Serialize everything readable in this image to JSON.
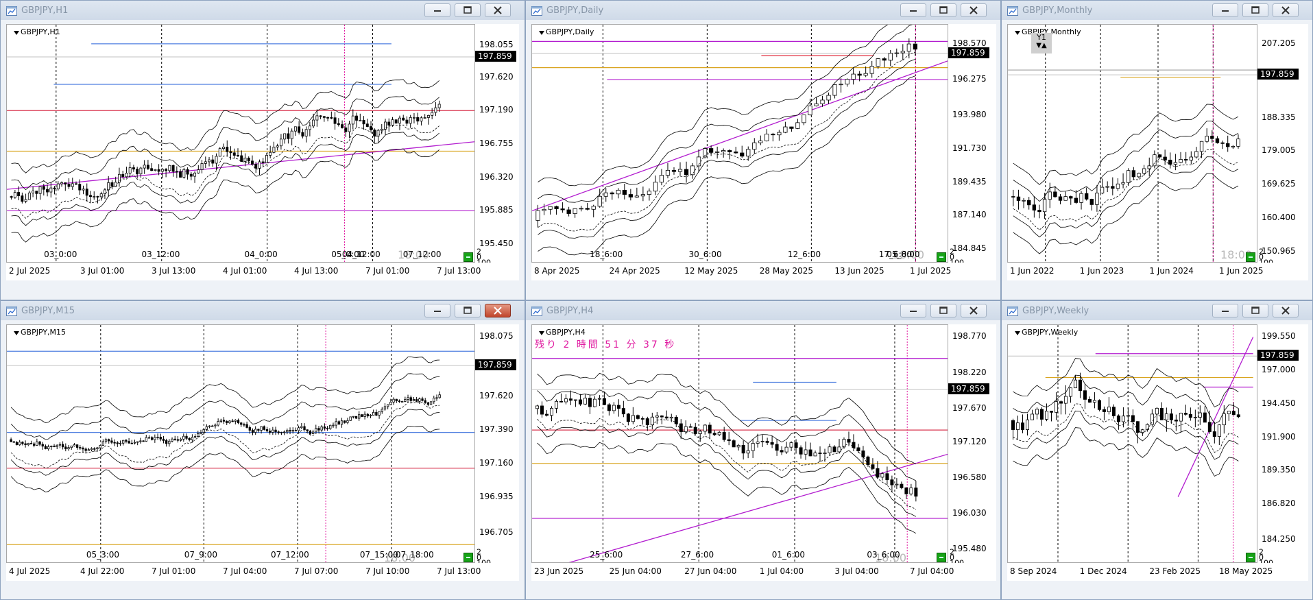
{
  "windows": [
    {
      "id": "h1",
      "title": "GBPJPY,H1",
      "symbol_label": "GBPJPY,H1",
      "time_stamp": "18:00",
      "current_price": "197.859",
      "price_labels": [
        "198.055",
        "197.620",
        "197.190",
        "196.755",
        "196.320",
        "195.885",
        "195.450"
      ],
      "intraday_labels": [
        "03_0:00",
        "03_12:00",
        "04_0:00",
        "04_12:00",
        "05_0:00",
        "07_12:00"
      ],
      "date_labels": [
        "2 Jul 2025",
        "3 Jul 01:00",
        "3 Jul 13:00",
        "4 Jul 01:00",
        "4 Jul 13:00",
        "7 Jul 01:00",
        "7 Jul 13:00"
      ],
      "scale_markers": [
        "2",
        "0",
        "100"
      ],
      "close_active": false
    },
    {
      "id": "daily",
      "title": "GBPJPY,Daily",
      "symbol_label": "GBPJPY,Daily",
      "time_stamp": "18:00",
      "current_price": "197.859",
      "price_labels": [
        "198.570",
        "196.275",
        "193.980",
        "191.730",
        "189.435",
        "187.140",
        "184.845"
      ],
      "intraday_labels": [
        "18_6:00",
        "30_6:00",
        "12_6:00",
        "05_6:00",
        "17_6:00"
      ],
      "date_labels": [
        "8 Apr 2025",
        "24 Apr 2025",
        "12 May 2025",
        "28 May 2025",
        "13 Jun 2025",
        "1 Jul 2025"
      ],
      "scale_markers": [
        "2",
        "0",
        "100"
      ],
      "close_active": false
    },
    {
      "id": "monthly",
      "title": "GBPJPY,Monthly",
      "symbol_label": "GBPJPY,Monthly",
      "time_stamp": "18:00",
      "current_price": "197.859",
      "price_labels": [
        "207.205",
        "197.859",
        "188.335",
        "179.005",
        "169.625",
        "160.400",
        "150.965"
      ],
      "date_labels": [
        "1 Jun 2022",
        "1 Jun 2023",
        "1 Jun 2024",
        "1 Jun 2025"
      ],
      "badge": "Y1",
      "scale_markers": [
        "2",
        "0",
        "100"
      ],
      "close_active": false
    },
    {
      "id": "m15",
      "title": "GBPJPY,M15",
      "symbol_label": "GBPJPY,M15",
      "time_stamp": "18:00",
      "current_price": "197.859",
      "price_labels": [
        "198.075",
        "197.620",
        "197.390",
        "197.160",
        "196.935",
        "196.705"
      ],
      "intraday_labels": [
        "05_3:00",
        "07_9:00",
        "07_12:00",
        "07_15:00",
        "07_18:00"
      ],
      "date_labels": [
        "4 Jul 2025",
        "4 Jul 22:00",
        "7 Jul 01:00",
        "7 Jul 04:00",
        "7 Jul 07:00",
        "7 Jul 10:00",
        "7 Jul 13:00"
      ],
      "scale_markers": [
        "2",
        "0",
        "100"
      ],
      "close_active": true
    },
    {
      "id": "h4",
      "title": "GBPJPY,H4",
      "symbol_label": "GBPJPY,H4",
      "time_stamp": "18:00",
      "current_price": "197.859",
      "countdown": "残り 2 時間 51 分 37 秒",
      "price_labels": [
        "198.770",
        "198.220",
        "197.670",
        "197.120",
        "196.580",
        "196.030",
        "195.480"
      ],
      "intraday_labels": [
        "25_6:00",
        "27_6:00",
        "01_6:00",
        "03_6:00"
      ],
      "date_labels": [
        "23 Jun 2025",
        "25 Jun 04:00",
        "27 Jun 04:00",
        "1 Jul 04:00",
        "3 Jul 04:00",
        "7 Jul 04:00"
      ],
      "scale_markers": [
        "2",
        "0",
        "100"
      ],
      "close_active": false
    },
    {
      "id": "weekly",
      "title": "GBPJPY,Weekly",
      "symbol_label": "GBPJPY,Weekly",
      "current_price": "197.859",
      "price_labels": [
        "199.550",
        "197.000",
        "194.450",
        "191.900",
        "189.350",
        "186.820",
        "184.250"
      ],
      "date_labels": [
        "8 Sep 2024",
        "1 Dec 2024",
        "23 Feb 2025",
        "18 May 2025"
      ],
      "scale_markers": [
        "2",
        "0",
        "100"
      ],
      "close_active": false
    }
  ],
  "colors": {
    "blue_line": "#4f7fe0",
    "red_line": "#d9344f",
    "orange_line": "#d9a520",
    "magenta_line": "#b21ccf",
    "pink_vline": "#e01aa0"
  }
}
